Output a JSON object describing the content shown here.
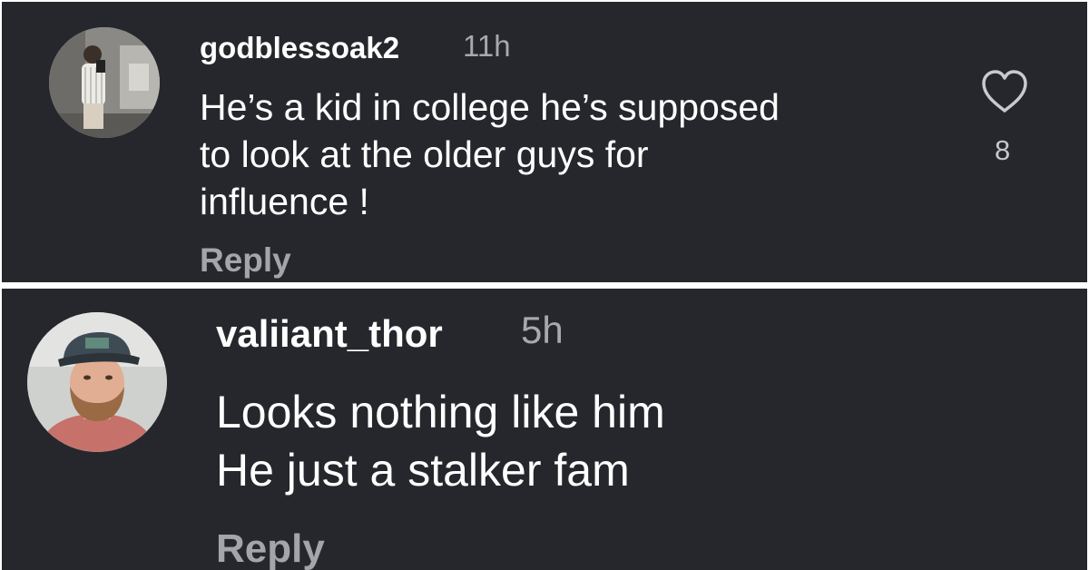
{
  "comments": [
    {
      "username": "godblessoak2",
      "time": "11h",
      "text_lines": [
        "He’s a kid in college he’s supposed",
        "to look at the older guys for",
        "influence !"
      ],
      "reply_label": "Reply",
      "like_count": "8",
      "avatar_icon": "profile-photo-icon",
      "like_icon": "heart-icon"
    },
    {
      "username": "valiiant_thor",
      "time": "5h",
      "text_lines": [
        "Looks nothing like him",
        "He just a stalker fam"
      ],
      "reply_label": "Reply",
      "avatar_icon": "profile-photo-icon"
    }
  ],
  "colors": {
    "panel_bg": "#25272c",
    "text_primary": "#ffffff",
    "text_secondary": "#a7a9ad",
    "separator": "#ffffff"
  }
}
